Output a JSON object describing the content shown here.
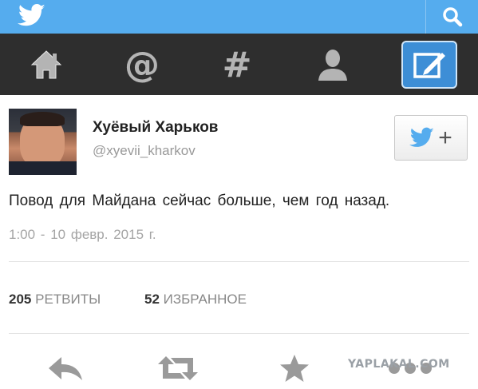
{
  "colors": {
    "brand": "#55acee",
    "navbar": "#2e2e2e",
    "compose": "#3d8ed6",
    "muted": "#999999"
  },
  "topbar": {
    "logo_icon": "twitter-bird-icon",
    "search_icon": "search-icon"
  },
  "nav": {
    "items": [
      {
        "icon": "home-icon"
      },
      {
        "icon": "at-sign-icon",
        "glyph": "@"
      },
      {
        "icon": "hashtag-icon",
        "glyph": "#"
      },
      {
        "icon": "profile-icon"
      },
      {
        "icon": "compose-icon"
      }
    ]
  },
  "tweet": {
    "author_name": "Хуёвый Харьков",
    "author_handle": "@xyevii_kharkov",
    "text": "Повод для Майдана сейчас больше, чем год назад.",
    "timestamp": "1:00 - 10 февр. 2015 г.",
    "retweets_count": "205",
    "retweets_label": "РЕТВИТЫ",
    "favorites_count": "52",
    "favorites_label": "ИЗБРАННОЕ",
    "follow_button_icon": "twitter-bird-plus-icon",
    "follow_button_plus": "+"
  },
  "actions": [
    {
      "icon": "reply-icon"
    },
    {
      "icon": "retweet-icon"
    },
    {
      "icon": "star-icon"
    },
    {
      "icon": "more-dots-icon"
    }
  ],
  "watermark": "YAPLAKAL.COM"
}
